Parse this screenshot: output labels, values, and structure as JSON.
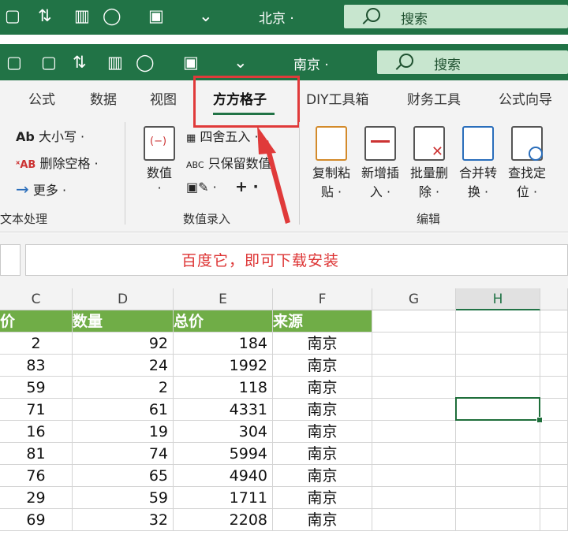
{
  "title_bar_back": {
    "city": "北京 ·",
    "search_label": "搜索"
  },
  "title_bar_front": {
    "city": "南京 ·",
    "search_label": "搜索"
  },
  "tabs": [
    "公式",
    "数据",
    "视图",
    "方方格子",
    "DIY工具箱",
    "财务工具",
    "公式向导"
  ],
  "active_tab": "方方格子",
  "text_group": {
    "items": [
      "大小写 ·",
      "删除空格 ·",
      "更多 ·"
    ],
    "icon_texts": [
      "Ab",
      "ˣAB",
      "→"
    ],
    "label": "文本处理"
  },
  "number_group": {
    "big_button": [
      "数值",
      "·"
    ],
    "items": [
      "四舍五入 ·",
      "只保留数值"
    ],
    "abc": "ABC",
    "plus": "+ ·",
    "label": "数值录入"
  },
  "edit_group": {
    "buttons": [
      {
        "l1": "复制粘",
        "l2": "贴 ·"
      },
      {
        "l1": "新增插",
        "l2": "入 ·"
      },
      {
        "l1": "批量删",
        "l2": "除 ·"
      },
      {
        "l1": "合并转",
        "l2": "换 ·"
      },
      {
        "l1": "查找定",
        "l2": "位 ·"
      }
    ],
    "label": "编辑"
  },
  "formula_bar": {
    "text": "百度它，即可下载安装"
  },
  "columns": [
    "C",
    "D",
    "E",
    "F",
    "G",
    "H"
  ],
  "selected_column": "H",
  "table": {
    "headers": [
      "价",
      "数量",
      "总价",
      "来源"
    ],
    "rows": [
      [
        2,
        92,
        184,
        "南京"
      ],
      [
        83,
        24,
        1992,
        "南京"
      ],
      [
        59,
        2,
        118,
        "南京"
      ],
      [
        71,
        61,
        4331,
        "南京"
      ],
      [
        16,
        19,
        304,
        "南京"
      ],
      [
        81,
        74,
        5994,
        "南京"
      ],
      [
        76,
        65,
        4940,
        "南京"
      ],
      [
        29,
        59,
        1711,
        "南京"
      ],
      [
        69,
        32,
        2208,
        "南京"
      ]
    ]
  },
  "colors": {
    "excel_green": "#217346",
    "header_fill": "#70ad47",
    "annotation_red": "#e03a3a"
  }
}
